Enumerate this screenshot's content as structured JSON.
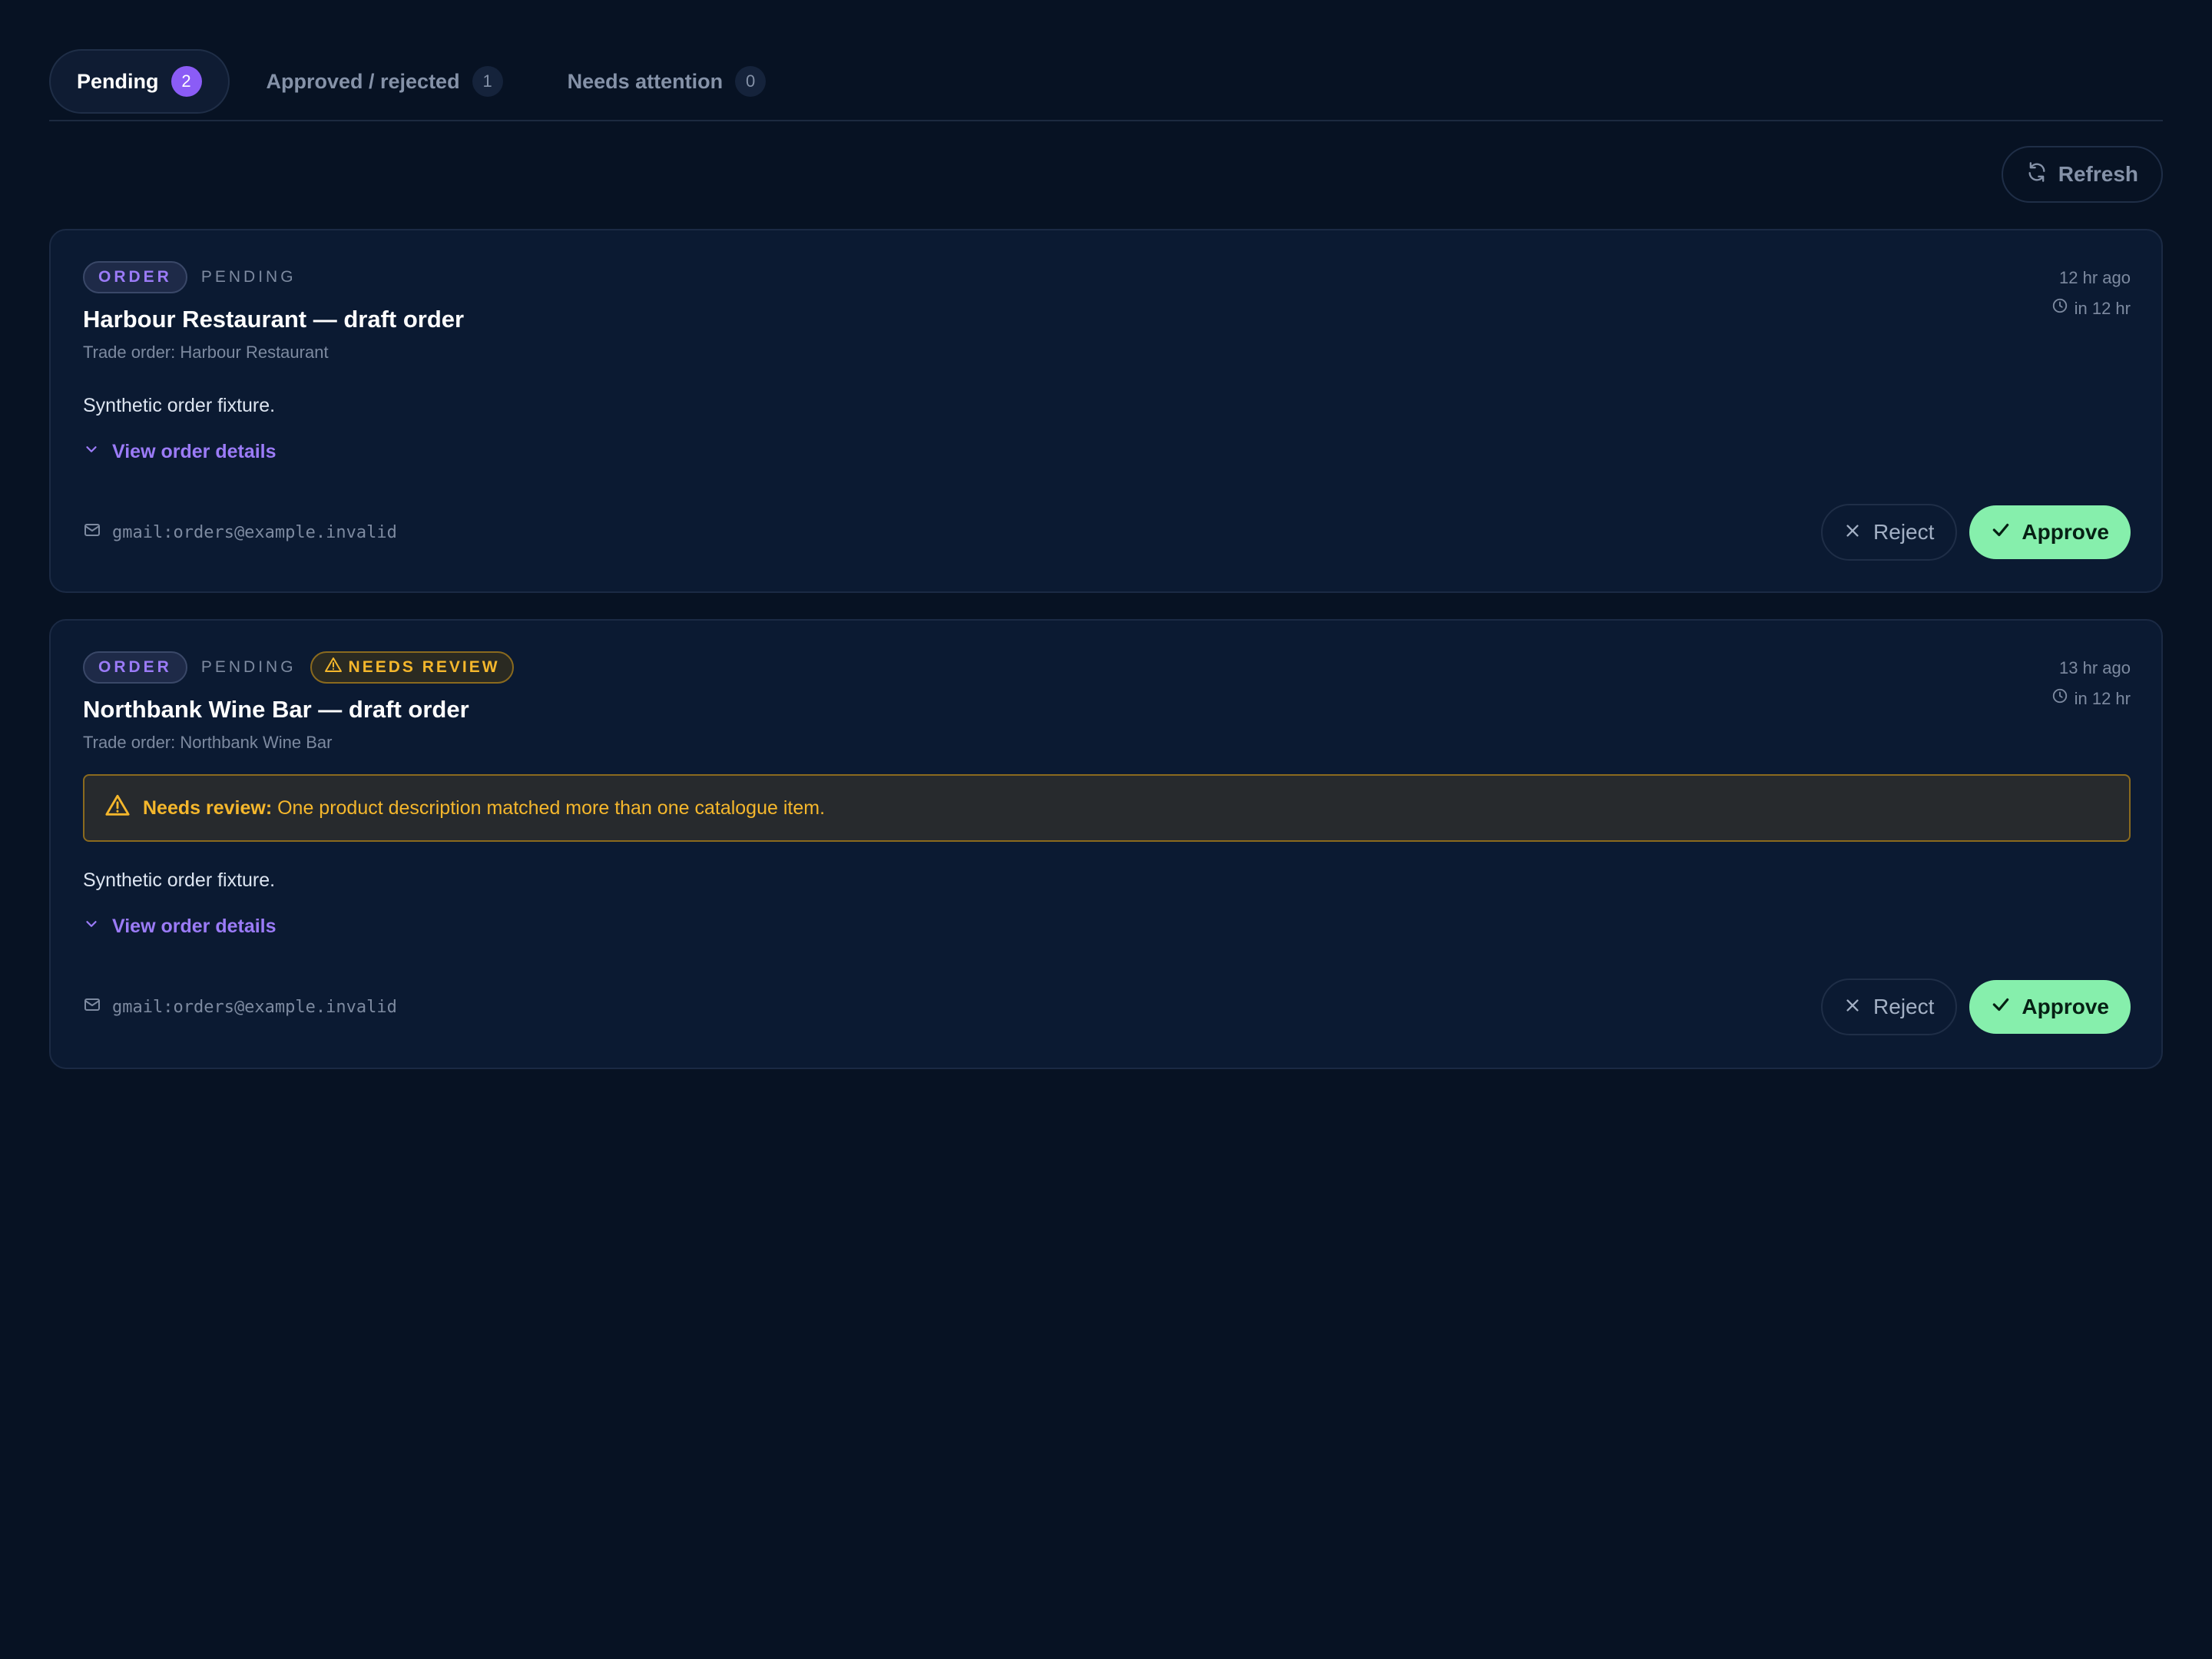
{
  "tabs": [
    {
      "label": "Pending",
      "count": "2",
      "active": true
    },
    {
      "label": "Approved / rejected",
      "count": "1",
      "active": false
    },
    {
      "label": "Needs attention",
      "count": "0",
      "active": false
    }
  ],
  "toolbar": {
    "refresh_label": "Refresh"
  },
  "cards": [
    {
      "type_badge": "ORDER",
      "status": "PENDING",
      "title": "Harbour Restaurant — draft order",
      "subtitle": "Trade order: Harbour Restaurant",
      "description": "Synthetic order fixture.",
      "details_link": "View order details",
      "created": "12 hr ago",
      "due": "in 12 hr",
      "source": "gmail:orders@example.invalid",
      "reject_label": "Reject",
      "approve_label": "Approve"
    },
    {
      "type_badge": "ORDER",
      "status": "PENDING",
      "review_badge": "NEEDS REVIEW",
      "title": "Northbank Wine Bar — draft order",
      "subtitle": "Trade order: Northbank Wine Bar",
      "alert_label": "Needs review:",
      "alert_text": "One product description matched more than one catalogue item.",
      "description": "Synthetic order fixture.",
      "details_link": "View order details",
      "created": "13 hr ago",
      "due": "in 12 hr",
      "source": "gmail:orders@example.invalid",
      "reject_label": "Reject",
      "approve_label": "Approve"
    }
  ],
  "colors": {
    "background": "#071223",
    "card": "#0b1a32",
    "accent": "#8b5cf6",
    "approve": "#86efac",
    "warning": "#f5b72c"
  }
}
